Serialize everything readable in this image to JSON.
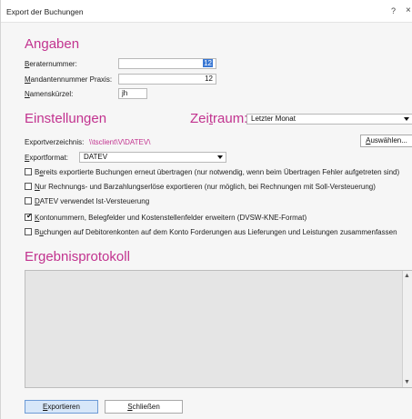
{
  "window": {
    "title": "Export der Buchungen",
    "help_symbol": "?",
    "close_symbol": "×"
  },
  "angaben": {
    "title": "Angaben",
    "beraternummer": {
      "label_first": "B",
      "label_rest": "eraternummer:",
      "value": "12"
    },
    "mandantennummer": {
      "label_first": "M",
      "label_rest": "andantennummer Praxis:",
      "value": "12"
    },
    "namenskuerzel": {
      "label_first": "N",
      "label_rest": "amenskürzel:",
      "value": "jh"
    }
  },
  "einstellungen": {
    "title": "Einstellungen",
    "zeitraum_label_a": "Zei",
    "zeitraum_label_b": "t",
    "zeitraum_label_c": "raum:",
    "zeitraum_value": "Letzter Monat",
    "exportverzeichnis_label": "Exportverzeichnis:",
    "exportverzeichnis_value": "\\\\tsclient\\V\\DATEV\\",
    "auswaehlen_first": "A",
    "auswaehlen_rest": "uswählen...",
    "exportformat_label_first": "E",
    "exportformat_label_rest": "xportformat:",
    "exportformat_value": "DATEV",
    "checkboxes": [
      {
        "pre": "B",
        "acc": "e",
        "post": "reits exportierte Buchungen erneut übertragen (nur notwendig, wenn beim Übertragen Fehler aufgetreten sind)",
        "checked": false
      },
      {
        "pre": "",
        "acc": "N",
        "post": "ur Rechnungs- und Barzahlungserlöse exportieren (nur möglich, bei Rechnungen mit Soll-Versteuerung)",
        "checked": false
      },
      {
        "pre": "",
        "acc": "D",
        "post": "ATEV verwendet Ist-Versteuerung",
        "checked": false
      },
      {
        "pre": "",
        "acc": "K",
        "post": "ontonummern, Belegfelder und Kostenstellenfelder erweitern (DVSW-KNE-Format)",
        "checked": true
      },
      {
        "pre": "B",
        "acc": "u",
        "post": "chungen auf Debitorenkonten auf dem Konto Forderungen aus Lieferungen und Leistungen zusammenfassen",
        "checked": false
      }
    ]
  },
  "ergebnisprotokoll": {
    "title": "Ergebnisprotokoll"
  },
  "footer": {
    "exportieren_first": "E",
    "exportieren_rest": "xportieren",
    "schliessen_first": "S",
    "schliessen_rest": "chließen"
  },
  "colors": {
    "accent": "#c2338f",
    "primary_button": "#d7e7f9",
    "selection": "#3a78d4"
  }
}
